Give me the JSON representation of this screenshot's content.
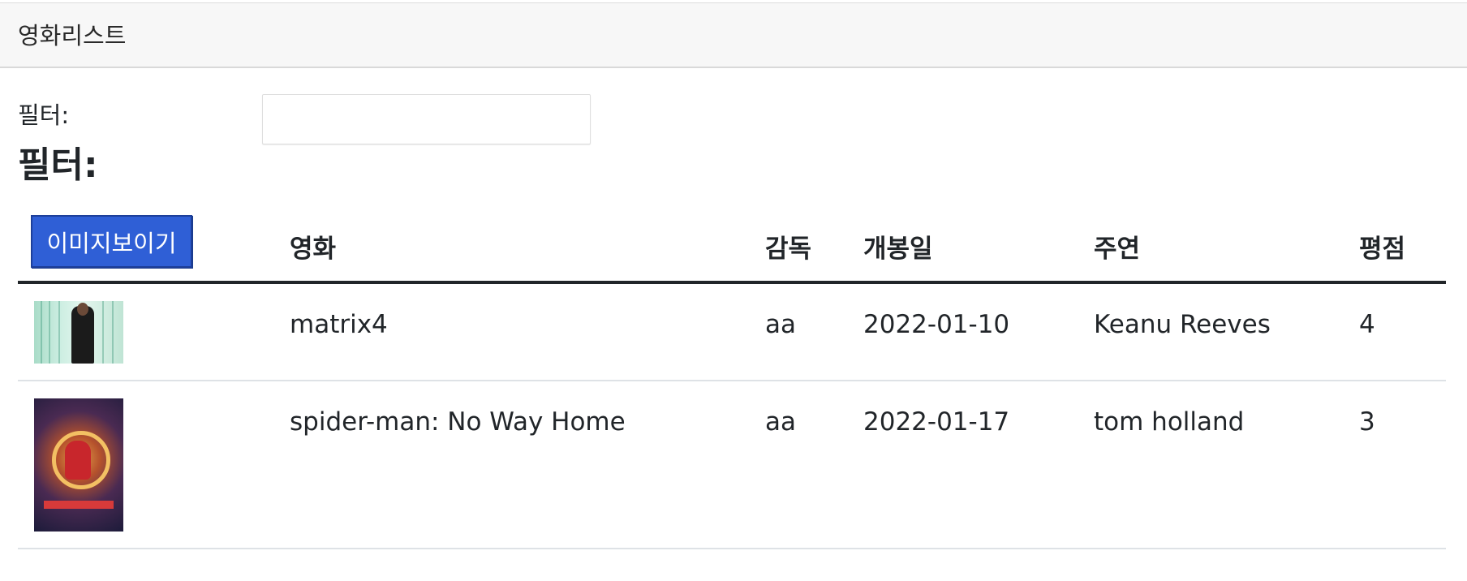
{
  "header": {
    "title": "영화리스트"
  },
  "filter": {
    "label": "필터:",
    "heading": "필터:",
    "input_value": "",
    "placeholder": ""
  },
  "table": {
    "toggle_button_label": "이미지보이기",
    "columns": [
      "영화",
      "감독",
      "개봉일",
      "주연",
      "평점"
    ],
    "rows": [
      {
        "poster_icon": "matrix-poster-image",
        "title": "matrix4",
        "director": "aa",
        "release_date": "2022-01-10",
        "lead_actor": "Keanu Reeves",
        "rating": "4"
      },
      {
        "poster_icon": "spider-man-poster-image",
        "title": "spider-man: No Way Home",
        "director": "aa",
        "release_date": "2022-01-17",
        "lead_actor": "tom holland",
        "rating": "3"
      }
    ]
  },
  "colors": {
    "button_bg": "#2f5fd6",
    "header_bg": "#f7f7f7",
    "text": "#212529"
  }
}
